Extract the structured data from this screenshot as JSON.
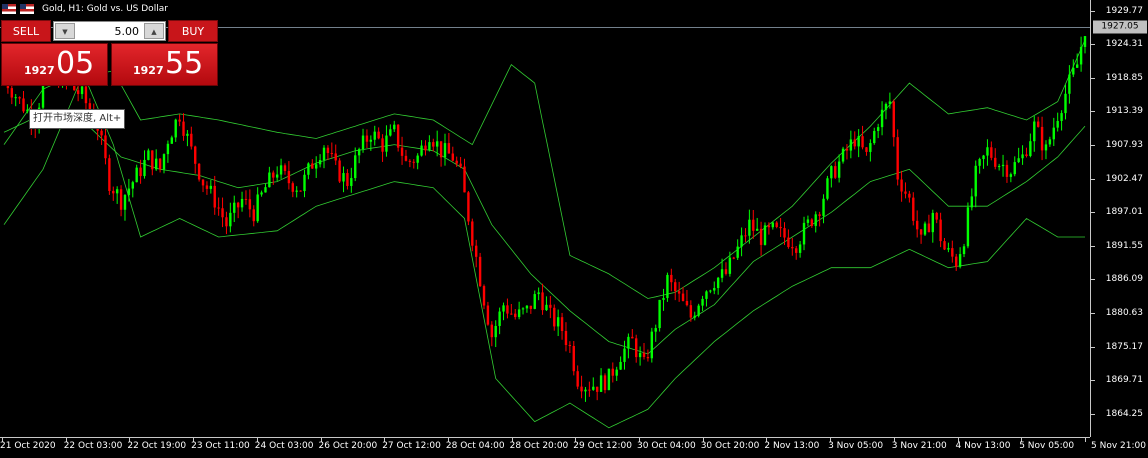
{
  "window": {
    "title": "Gold, H1:  Gold vs. US Dollar"
  },
  "trade_panel": {
    "sell_label": "SELL",
    "buy_label": "BUY",
    "lot_value": "5.00",
    "sell_quote": {
      "big_figure": "1927",
      "pips": "05"
    },
    "buy_quote": {
      "big_figure": "1927",
      "pips": "55"
    }
  },
  "tooltip": "打开市场深度, Alt+",
  "current_price": "1927.05",
  "price_axis": [
    "1929.77",
    "1924.31",
    "1918.85",
    "1913.39",
    "1907.93",
    "1902.47",
    "1897.01",
    "1891.55",
    "1886.09",
    "1880.63",
    "1875.17",
    "1869.71",
    "1864.25"
  ],
  "time_axis": [
    "21 Oct 2020",
    "22 Oct 03:00",
    "22 Oct 19:00",
    "23 Oct 11:00",
    "24 Oct 03:00",
    "26 Oct 20:00",
    "27 Oct 12:00",
    "28 Oct 04:00",
    "28 Oct 20:00",
    "29 Oct 12:00",
    "30 Oct 04:00",
    "30 Oct 20:00",
    "2 Nov 13:00",
    "3 Nov 05:00",
    "3 Nov 21:00",
    "4 Nov 13:00",
    "5 Nov 05:00",
    "5 Nov 21:00"
  ],
  "colors": {
    "background": "#000000",
    "bull_candle": "#00ff00",
    "bear_candle": "#ff0000",
    "bands": "#32cd32",
    "button_red": "#c8151a"
  },
  "chart_data": {
    "type": "candlestick",
    "title": "Gold, H1:  Gold vs. US Dollar",
    "ylim": [
      1860.5,
      1931.5
    ],
    "current_price": 1927.05,
    "close_path": [
      [
        0,
        1919
      ],
      [
        4,
        1915
      ],
      [
        8,
        1912
      ],
      [
        10,
        1918
      ],
      [
        14,
        1919
      ],
      [
        18,
        1917
      ],
      [
        20,
        1916
      ],
      [
        24,
        1911
      ],
      [
        27,
        1902
      ],
      [
        30,
        1899
      ],
      [
        34,
        1903
      ],
      [
        37,
        1906
      ],
      [
        40,
        1904
      ],
      [
        42,
        1909
      ],
      [
        45,
        1913
      ],
      [
        48,
        1907
      ],
      [
        51,
        1902
      ],
      [
        54,
        1899
      ],
      [
        57,
        1895
      ],
      [
        61,
        1899
      ],
      [
        64,
        1897
      ],
      [
        67,
        1901
      ],
      [
        70,
        1904
      ],
      [
        73,
        1902
      ],
      [
        76,
        1901
      ],
      [
        79,
        1905
      ],
      [
        82,
        1908
      ],
      [
        85,
        1904
      ],
      [
        88,
        1902
      ],
      [
        91,
        1907
      ],
      [
        94,
        1910
      ],
      [
        97,
        1908
      ],
      [
        100,
        1910
      ],
      [
        103,
        1905
      ],
      [
        106,
        1906
      ],
      [
        109,
        1910
      ],
      [
        112,
        1907
      ],
      [
        115,
        1906
      ],
      [
        117,
        1903
      ],
      [
        120,
        1893
      ],
      [
        123,
        1883
      ],
      [
        125,
        1877
      ],
      [
        128,
        1882
      ],
      [
        131,
        1880
      ],
      [
        134,
        1881
      ],
      [
        137,
        1884
      ],
      [
        140,
        1880
      ],
      [
        143,
        1878
      ],
      [
        145,
        1875
      ],
      [
        147,
        1870
      ],
      [
        149,
        1869
      ],
      [
        152,
        1869
      ],
      [
        155,
        1870
      ],
      [
        158,
        1874
      ],
      [
        161,
        1876
      ],
      [
        164,
        1872
      ],
      [
        167,
        1879
      ],
      [
        170,
        1886
      ],
      [
        173,
        1883
      ],
      [
        176,
        1880
      ],
      [
        179,
        1884
      ],
      [
        182,
        1886
      ],
      [
        185,
        1887
      ],
      [
        188,
        1891
      ],
      [
        191,
        1895
      ],
      [
        194,
        1893
      ],
      [
        197,
        1894
      ],
      [
        200,
        1893
      ],
      [
        203,
        1892
      ],
      [
        206,
        1895
      ],
      [
        209,
        1898
      ],
      [
        212,
        1903
      ],
      [
        215,
        1906
      ],
      [
        218,
        1909
      ],
      [
        221,
        1906
      ],
      [
        224,
        1912
      ],
      [
        227,
        1915
      ],
      [
        229,
        1903
      ],
      [
        232,
        1899
      ],
      [
        235,
        1892
      ],
      [
        238,
        1897
      ],
      [
        241,
        1891
      ],
      [
        244,
        1889
      ],
      [
        246,
        1893
      ],
      [
        249,
        1903
      ],
      [
        252,
        1907
      ],
      [
        255,
        1905
      ],
      [
        258,
        1904
      ],
      [
        261,
        1906
      ],
      [
        264,
        1911
      ],
      [
        267,
        1907
      ],
      [
        270,
        1913
      ],
      [
        273,
        1918
      ],
      [
        275,
        1921
      ],
      [
        277,
        1927
      ]
    ],
    "bollinger": {
      "middle": [
        [
          0,
          1910
        ],
        [
          10,
          1913
        ],
        [
          20,
          1912
        ],
        [
          30,
          1906
        ],
        [
          40,
          1904
        ],
        [
          50,
          1903
        ],
        [
          60,
          1901
        ],
        [
          70,
          1902
        ],
        [
          80,
          1905
        ],
        [
          90,
          1907
        ],
        [
          100,
          1908
        ],
        [
          110,
          1907
        ],
        [
          118,
          1904
        ],
        [
          125,
          1895
        ],
        [
          135,
          1887
        ],
        [
          145,
          1881
        ],
        [
          155,
          1876
        ],
        [
          165,
          1874
        ],
        [
          172,
          1878
        ],
        [
          182,
          1882
        ],
        [
          192,
          1889
        ],
        [
          202,
          1893
        ],
        [
          212,
          1897
        ],
        [
          222,
          1902
        ],
        [
          232,
          1904
        ],
        [
          242,
          1898
        ],
        [
          252,
          1898
        ],
        [
          262,
          1902
        ],
        [
          270,
          1906
        ],
        [
          277,
          1911
        ]
      ],
      "upper": [
        [
          0,
          1895
        ],
        [
          10,
          1904
        ],
        [
          20,
          1919
        ],
        [
          28,
          1920
        ],
        [
          35,
          1912
        ],
        [
          45,
          1913
        ],
        [
          55,
          1912
        ],
        [
          70,
          1910
        ],
        [
          80,
          1909
        ],
        [
          90,
          1911
        ],
        [
          100,
          1913
        ],
        [
          110,
          1912
        ],
        [
          120,
          1908
        ],
        [
          130,
          1921
        ],
        [
          136,
          1918
        ],
        [
          145,
          1890
        ],
        [
          155,
          1887
        ],
        [
          165,
          1883
        ],
        [
          172,
          1884
        ],
        [
          182,
          1888
        ],
        [
          192,
          1893
        ],
        [
          202,
          1898
        ],
        [
          212,
          1905
        ],
        [
          222,
          1911
        ],
        [
          232,
          1918
        ],
        [
          242,
          1913
        ],
        [
          252,
          1914
        ],
        [
          262,
          1912
        ],
        [
          270,
          1915
        ],
        [
          277,
          1925
        ]
      ],
      "lower": [
        [
          0,
          1908
        ],
        [
          10,
          1917
        ],
        [
          20,
          1920
        ],
        [
          28,
          1908
        ],
        [
          35,
          1893
        ],
        [
          45,
          1896
        ],
        [
          55,
          1893
        ],
        [
          70,
          1894
        ],
        [
          80,
          1898
        ],
        [
          90,
          1900
        ],
        [
          100,
          1902
        ],
        [
          110,
          1901
        ],
        [
          118,
          1896
        ],
        [
          126,
          1870
        ],
        [
          136,
          1863
        ],
        [
          145,
          1866
        ],
        [
          155,
          1862
        ],
        [
          165,
          1865
        ],
        [
          172,
          1870
        ],
        [
          182,
          1876
        ],
        [
          192,
          1881
        ],
        [
          202,
          1885
        ],
        [
          212,
          1888
        ],
        [
          222,
          1888
        ],
        [
          232,
          1891
        ],
        [
          242,
          1888
        ],
        [
          252,
          1889
        ],
        [
          262,
          1896
        ],
        [
          270,
          1893
        ],
        [
          277,
          1893
        ]
      ]
    }
  }
}
